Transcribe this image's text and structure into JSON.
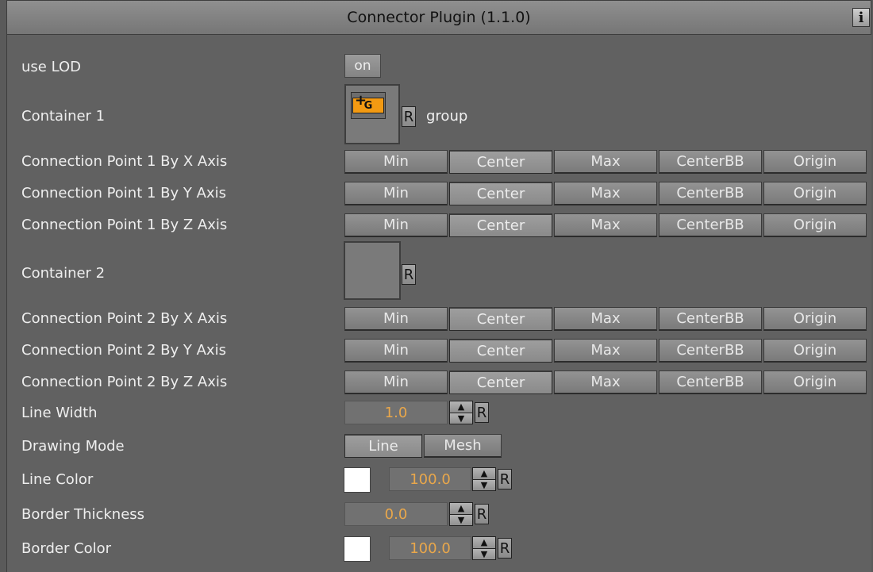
{
  "header": {
    "title": "Connector Plugin (1.1.0)",
    "info_label": "i"
  },
  "use_lod": {
    "label": "use LOD",
    "value": "on"
  },
  "container1": {
    "label": "Container 1",
    "icon_text": "G",
    "reset": "R",
    "name": "group"
  },
  "container2": {
    "label": "Container 2",
    "reset": "R"
  },
  "axis_options": [
    "Min",
    "Center",
    "Max",
    "CenterBB",
    "Origin"
  ],
  "axis_rows": [
    {
      "label": "Connection Point 1 By X Axis",
      "selected": "Center"
    },
    {
      "label": "Connection Point 1 By Y Axis",
      "selected": "Center"
    },
    {
      "label": "Connection Point 1 By Z Axis",
      "selected": "Center"
    },
    {
      "label": "Connection Point 2 By X Axis",
      "selected": "Center"
    },
    {
      "label": "Connection Point 2 By Y Axis",
      "selected": "Center"
    },
    {
      "label": "Connection Point 2 By Z Axis",
      "selected": "Center"
    }
  ],
  "line_width": {
    "label": "Line Width",
    "value": "1.0",
    "reset": "R"
  },
  "drawing_mode": {
    "label": "Drawing Mode",
    "options": [
      "Line",
      "Mesh"
    ],
    "selected": "Line"
  },
  "line_color": {
    "label": "Line Color",
    "value": "100.0",
    "reset": "R",
    "swatch": "#ffffff"
  },
  "border_thickness": {
    "label": "Border Thickness",
    "value": "0.0",
    "reset": "R"
  },
  "border_color": {
    "label": "Border Color",
    "value": "100.0",
    "reset": "R",
    "swatch": "#ffffff"
  },
  "colors": {
    "panel_bg": "#616161",
    "value_text": "#e9a74b",
    "group_icon": "#f39a12"
  }
}
